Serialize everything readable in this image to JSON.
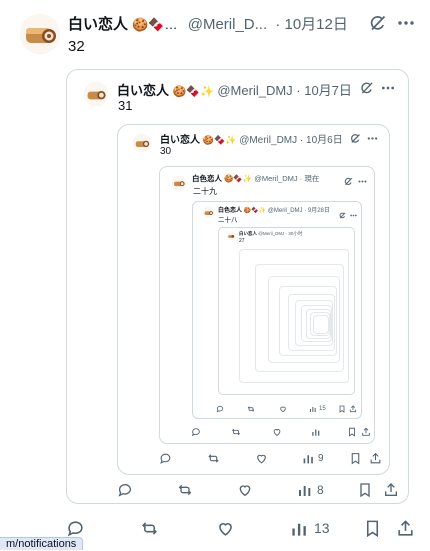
{
  "tweet": {
    "name": "白い恋人",
    "emoji": "🍪🍫…",
    "handle": "@Meril_D...",
    "date": "· 10月12日",
    "text": "32",
    "actions": {
      "views": "13"
    }
  },
  "quote1": {
    "name": "白い恋人",
    "emoji": "🍪🍫✨",
    "handle": "@Meril_DMJ · 10月7日",
    "text": "31",
    "views": "8"
  },
  "quote2": {
    "name": "白い恋人",
    "emoji": "🍪🍫✨",
    "handle": "@Meril_DMJ · 10月6日",
    "text": "30",
    "views": "9"
  },
  "quote3": {
    "name": "白色恋人",
    "emoji": "🍪🍫✨",
    "handle": "@Meril_DMJ · 現在",
    "text": "二十九"
  },
  "quote4": {
    "name": "白色恋人",
    "emoji": "🍪🍫✨",
    "handle": "@Meril_DMJ · 9月28日",
    "text": "二十八",
    "views": "15"
  },
  "quote5": {
    "name": "白い恋人",
    "handle": "@Meril_DMJ · 30小时",
    "text": "27"
  },
  "status_url": "m/notifications"
}
